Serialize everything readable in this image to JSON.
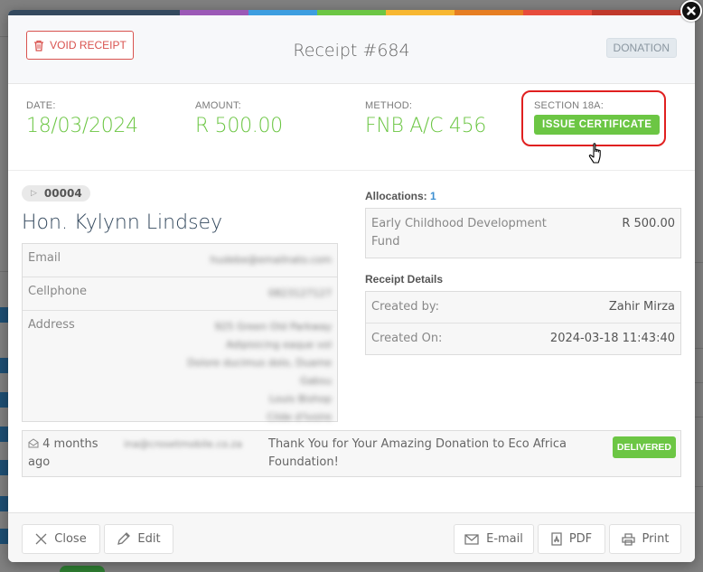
{
  "modal": {
    "title": "Receipt #684",
    "void_label": "VOID RECEIPT",
    "type_badge": "DONATION",
    "stripe_colors": [
      "#34495e",
      "#9b59b6",
      "#3d9ee0",
      "#6cc644",
      "#f7b731",
      "#e67e22",
      "#e74c3c",
      "#c0392b"
    ]
  },
  "summary": {
    "date_label": "DATE:",
    "date_value": "18/03/2024",
    "amount_label": "AMOUNT:",
    "amount_value": "R 500.00",
    "method_label": "METHOD:",
    "method_value": "FNB A/C 456",
    "section_label": "SECTION 18A:",
    "issue_certificate_label": "ISSUE CERTIFICATE"
  },
  "donor": {
    "id": "00004",
    "name": "Hon. Kylynn Lindsey",
    "fields": [
      {
        "label": "Email",
        "value": "[blurred]"
      },
      {
        "label": "Cellphone",
        "value": "[blurred]"
      },
      {
        "label": "Address",
        "value": "[blurred]"
      }
    ]
  },
  "allocations": {
    "title": "Allocations:",
    "count": "1",
    "items": [
      {
        "name": "Early Childhood Development Fund",
        "amount": "R 500.00"
      }
    ]
  },
  "receipt_details": {
    "title": "Receipt Details",
    "rows": [
      {
        "label": "Created by:",
        "value": "Zahir Mirza"
      },
      {
        "label": "Created On:",
        "value": "2024-03-18 11:43:40"
      }
    ]
  },
  "message": {
    "when": "4 months ago",
    "to": "[blurred]",
    "subject": "Thank You for Your Amazing Donation to Eco Africa Foundation!",
    "status": "DELIVERED"
  },
  "footer": {
    "close_label": "Close",
    "edit_label": "Edit",
    "email_label": "E-mail",
    "pdf_label": "PDF",
    "print_label": "Print"
  },
  "colors": {
    "accent_green": "#6cc644",
    "danger_red": "#d9534f",
    "highlight_red": "#e02020",
    "link_blue": "#3d8fd1"
  }
}
